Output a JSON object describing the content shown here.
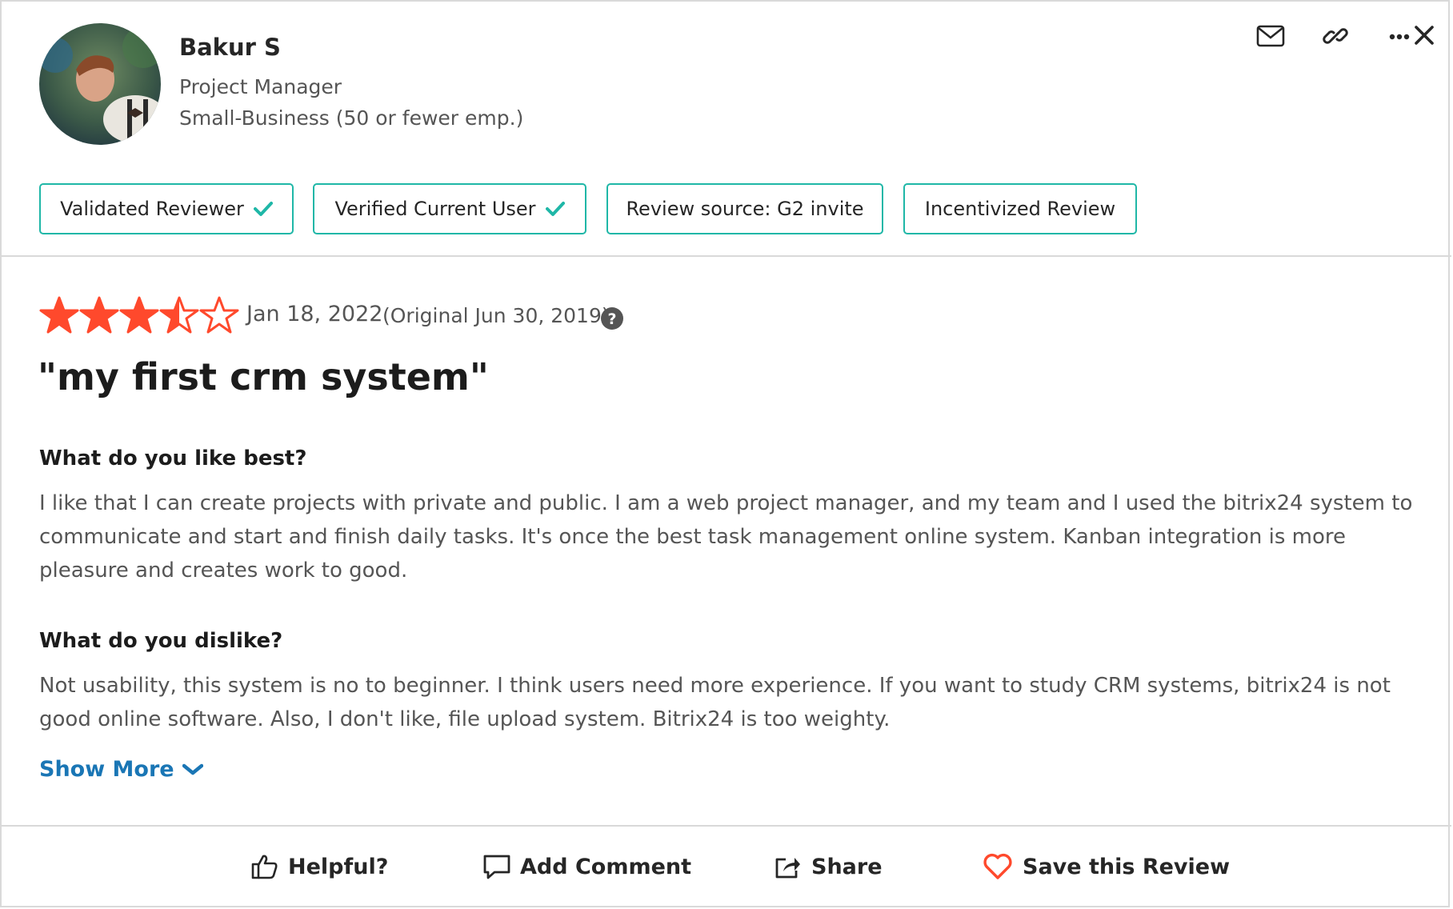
{
  "reviewer": {
    "name": "Bakur S",
    "role": "Project Manager",
    "company_size": "Small-Business (50 or fewer emp.)"
  },
  "header_actions": [
    {
      "icon": "mail-icon"
    },
    {
      "icon": "link-icon"
    },
    {
      "icon": "more-icon"
    },
    {
      "icon": "close-icon"
    }
  ],
  "badges": [
    {
      "label": "Validated Reviewer",
      "check": true
    },
    {
      "label": "Verified Current User",
      "check": true
    },
    {
      "label": "Review source: G2 invite",
      "check": false
    },
    {
      "label": "Incentivized Review",
      "check": false
    }
  ],
  "review": {
    "rating": 3.5,
    "rating_max": 5,
    "date": "Jan 18, 2022",
    "original": "(Original Jun 30, 2019)",
    "title": "\"my first crm system\"",
    "questions": [
      {
        "heading": "What do you like best?",
        "answer": "I like that I can create projects with private and public. I am a web project manager, and my team and I used the bitrix24 system to communicate and start and finish daily tasks. It's once the best task management online system. Kanban integration is more pleasure and creates work to good."
      },
      {
        "heading": "What do you dislike?",
        "answer": "Not usability, this system is no to beginner. I think users need more experience. If you want to study CRM systems, bitrix24 is not good online software. Also, I don't like, file upload system. Bitrix24 is too weighty."
      }
    ],
    "show_more": "Show More"
  },
  "footer": {
    "helpful": "Helpful?",
    "add_comment": "Add Comment",
    "share": "Share",
    "save": "Save this Review"
  },
  "colors": {
    "star": "#ff492c",
    "badge_border": "#1fb7a7",
    "check": "#1fb7a7",
    "link": "#1a76b5",
    "heart": "#ff492c"
  }
}
